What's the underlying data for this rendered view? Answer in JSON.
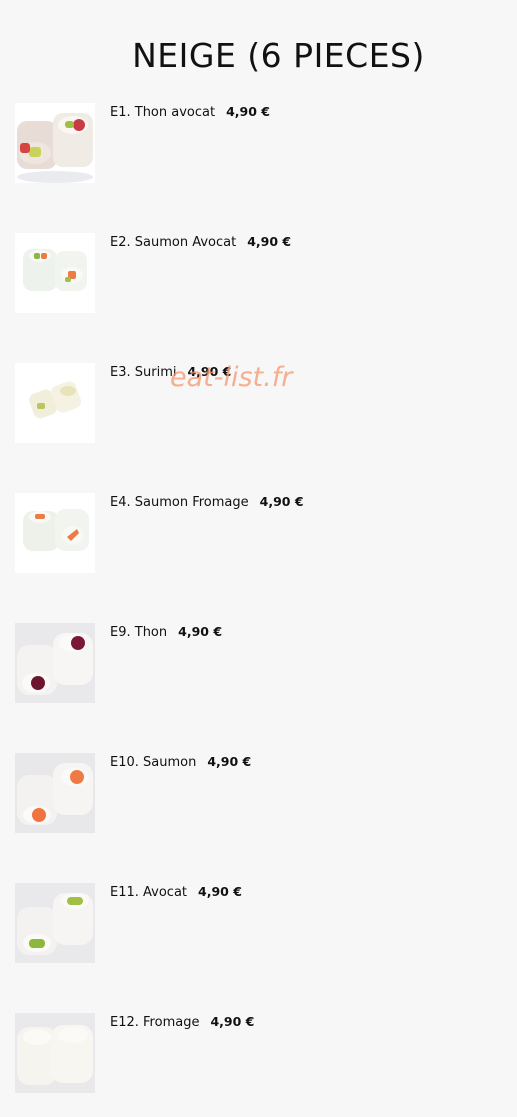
{
  "section": {
    "title": "NEIGE (6 PIECES)"
  },
  "items": [
    {
      "name": "E1. Thon avocat",
      "price": "4,90 €",
      "image": "sushi-tuna-avocado"
    },
    {
      "name": "E2. Saumon Avocat",
      "price": "4,90 €",
      "image": "sushi-salmon-avocado"
    },
    {
      "name": "E3. Surimi",
      "price": "4,90 €",
      "image": "sushi-surimi"
    },
    {
      "name": "E4. Saumon Fromage",
      "price": "4,90 €",
      "image": "sushi-salmon-cheese"
    },
    {
      "name": "E9. Thon",
      "price": "4,90 €",
      "image": "sushi-tuna"
    },
    {
      "name": "E10. Saumon",
      "price": "4,90 €",
      "image": "sushi-salmon"
    },
    {
      "name": "E11. Avocat",
      "price": "4,90 €",
      "image": "sushi-avocado"
    },
    {
      "name": "E12. Fromage",
      "price": "4,90 €",
      "image": "sushi-cheese"
    }
  ],
  "watermark": "eat-list.fr",
  "colors": {
    "background": "#f7f7f7",
    "text": "#111111",
    "watermark": "#f4966e",
    "tuna": "#a8253a",
    "salmon": "#f07a45",
    "avocado": "#9fbf45",
    "cheese": "#f3eed8"
  }
}
